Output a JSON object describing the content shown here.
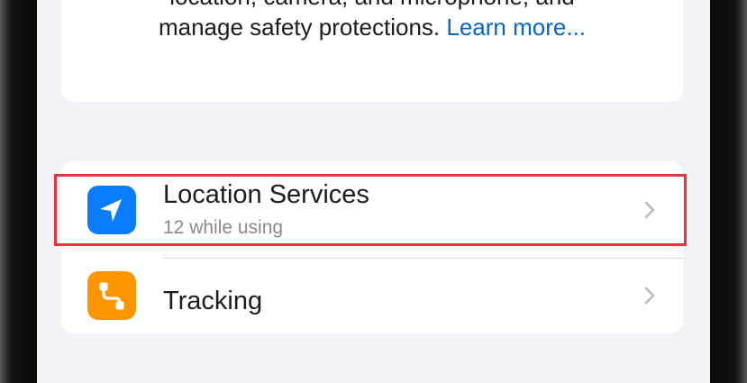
{
  "privacy_info": {
    "line1": "location, camera, and microphone, and",
    "line2_text": "manage safety protections.",
    "learn_more_link": "Learn more..."
  },
  "settings_list": [
    {
      "title": "Location Services",
      "subtitle": "12 while using",
      "icon": "location-arrow-icon",
      "icon_color": "#0a7cff",
      "highlighted": true
    },
    {
      "title": "Tracking",
      "icon": "tracking-icon",
      "icon_color": "#ff9500"
    }
  ],
  "highlight_color": "#e8343c"
}
